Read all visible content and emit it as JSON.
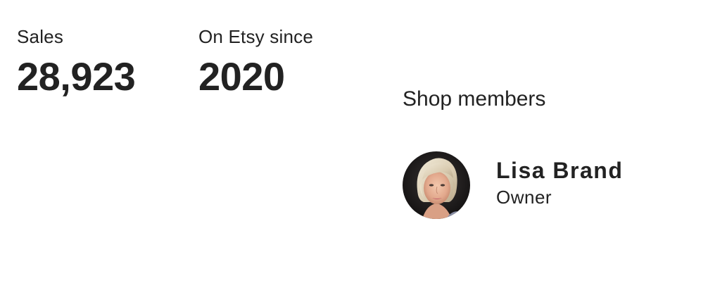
{
  "stats": [
    {
      "label": "Sales",
      "value": "28,923"
    },
    {
      "label": "On Etsy since",
      "value": "2020"
    }
  ],
  "shop_members": {
    "heading": "Shop members",
    "members": [
      {
        "name": "Lisa Brand",
        "role": "Owner",
        "avatar": "member-photo"
      }
    ]
  },
  "colors": {
    "text": "#222222",
    "background": "#ffffff"
  }
}
